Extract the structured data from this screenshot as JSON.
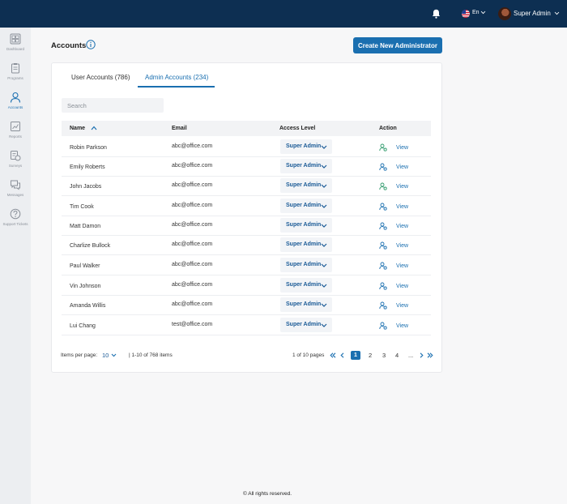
{
  "header": {
    "language": "En",
    "user_name": "Super Admin"
  },
  "sidebar": {
    "items": [
      {
        "label": "Dashboard",
        "icon": "dashboard-icon"
      },
      {
        "label": "Programs",
        "icon": "clipboard-icon"
      },
      {
        "label": "Accounts",
        "icon": "user-icon",
        "active": true
      },
      {
        "label": "Reports",
        "icon": "chart-icon"
      },
      {
        "label": "Surveys",
        "icon": "survey-icon"
      },
      {
        "label": "Messages",
        "icon": "messages-icon"
      },
      {
        "label": "Support Tickets",
        "icon": "help-icon"
      }
    ]
  },
  "page": {
    "title": "Accounts",
    "create_button": "Create New Administrator"
  },
  "tabs": [
    {
      "label": "User Accounts (786)"
    },
    {
      "label": "Admin Accounts (234)",
      "active": true
    }
  ],
  "search": {
    "placeholder": "Search"
  },
  "table": {
    "columns": {
      "name": "Name",
      "email": "Email",
      "access": "Access Level",
      "action": "Action"
    },
    "rows": [
      {
        "name": "Robin Parkson",
        "email": "abc@office.com",
        "access": "Super Admin",
        "action": "View",
        "icon_color": "#2e9a6b"
      },
      {
        "name": "Emily Roberts",
        "email": "abc@office.com",
        "access": "Super Admin",
        "action": "View",
        "icon_color": "#1a6fb0"
      },
      {
        "name": "John Jacobs",
        "email": "abc@office.com",
        "access": "Super Admin",
        "action": "View",
        "icon_color": "#2e9a6b"
      },
      {
        "name": "Tim Cook",
        "email": "abc@office.com",
        "access": "Super Admin",
        "action": "View",
        "icon_color": "#1a6fb0"
      },
      {
        "name": "Matt Damon",
        "email": "abc@office.com",
        "access": "Super Admin",
        "action": "View",
        "icon_color": "#1a6fb0"
      },
      {
        "name": "Charlize Bullock",
        "email": "abc@office.com",
        "access": "Super Admin",
        "action": "View",
        "icon_color": "#1a6fb0"
      },
      {
        "name": "Paul Walker",
        "email": "abc@office.com",
        "access": "Super Admin",
        "action": "View",
        "icon_color": "#1a6fb0"
      },
      {
        "name": "Vin Johnson",
        "email": "abc@office.com",
        "access": "Super Admin",
        "action": "View",
        "icon_color": "#1a6fb0"
      },
      {
        "name": "Amanda Willis",
        "email": "abc@office.com",
        "access": "Super Admin",
        "action": "View",
        "icon_color": "#1a6fb0"
      },
      {
        "name": "Lui Chang",
        "email": "test@office.com",
        "access": "Super Admin",
        "action": "View",
        "icon_color": "#1a6fb0"
      }
    ]
  },
  "pagination": {
    "items_per_page_label": "Items per page:",
    "items_per_page": "10",
    "range": "| 1-10 of 768 items",
    "page_info": "1 of 10 pages",
    "pages": [
      "1",
      "2",
      "3",
      "4",
      "..."
    ],
    "current_page": "1"
  },
  "footer": "© All rights reserved.",
  "colors": {
    "accent": "#1a6fb0",
    "topbar": "#0d2f52",
    "success": "#2e9a6b"
  }
}
